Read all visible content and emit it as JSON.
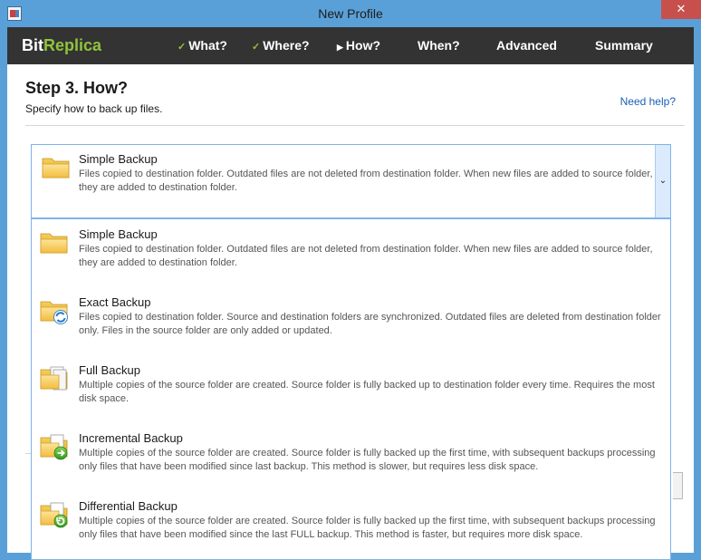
{
  "window": {
    "title": "New Profile",
    "close_label": "✕"
  },
  "brand": {
    "name_part1": "Bit",
    "name_part2": "Replica",
    "accent_color": "#8fc43a"
  },
  "nav": [
    {
      "label": "What?",
      "marker": "✓",
      "state": "done"
    },
    {
      "label": "Where?",
      "marker": "✓",
      "state": "done"
    },
    {
      "label": "How?",
      "marker": "▶",
      "state": "current"
    },
    {
      "label": "When?",
      "marker": "",
      "state": "pending"
    },
    {
      "label": "Advanced",
      "marker": "",
      "state": "pending"
    },
    {
      "label": "Summary",
      "marker": "",
      "state": "pending"
    }
  ],
  "step": {
    "title": "Step 3. How?",
    "subtitle": "Specify how to back up files.",
    "help_link": "Need help?"
  },
  "combo": {
    "selected_title": "Simple Backup",
    "selected_desc": "Files copied to destination folder. Outdated files are not deleted from destination folder. When new files are added to source folder, they are added to destination folder.",
    "arrow": "⌄"
  },
  "options": [
    {
      "title": "Simple Backup",
      "desc": "Files copied to destination folder. Outdated files are not deleted from destination folder. When new files are added to source folder, they are added to destination folder.",
      "icon": "folder-icon"
    },
    {
      "title": "Exact Backup",
      "desc": "Files copied to destination folder. Source and destination folders are synchronized. Outdated files are deleted from destination folder only. Files in the source folder are only added or updated.",
      "icon": "folder-sync-icon"
    },
    {
      "title": "Full Backup",
      "desc": "Multiple copies of the source folder are created. Source folder is fully backed up to destination folder every time. Requires the most disk space.",
      "icon": "folder-documents-icon"
    },
    {
      "title": "Incremental Backup",
      "desc": "Multiple copies of the source folder are created. Source folder is fully backed up the first time, with subsequent backups processing only files that have been modified since last backup. This method is slower, but requires less disk space.",
      "icon": "folder-incremental-icon"
    },
    {
      "title": "Differential Backup",
      "desc": "Multiple copies of the source folder are created. Source folder is fully backed up the first time, with subsequent backups processing only files that have been modified since the last FULL backup. This method is faster, but requires more disk space.",
      "icon": "folder-differential-icon"
    }
  ]
}
